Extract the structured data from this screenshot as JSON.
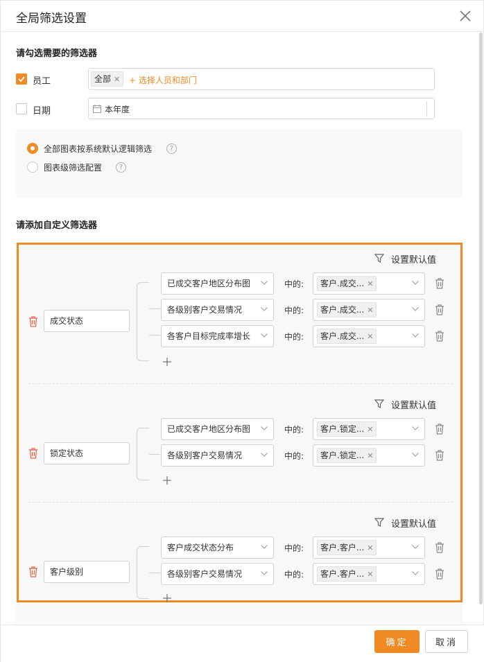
{
  "dialog": {
    "title": "全局筛选设置"
  },
  "section1": {
    "title": "请勾选需要的筛选器",
    "employee": {
      "label": "员工",
      "checked": true,
      "tag": "全部",
      "add_link": "+ 选择人员和部门"
    },
    "date": {
      "label": "日期",
      "checked": false,
      "value": "本年度"
    }
  },
  "logic": {
    "options": [
      {
        "label": "全部图表按系统默认逻辑筛选",
        "selected": true
      },
      {
        "label": "图表级筛选配置",
        "selected": false
      }
    ]
  },
  "section2": {
    "title": "请添加自定义筛选器",
    "set_default_label": "设置默认值",
    "in_label": "中的:",
    "groups": [
      {
        "name": "成交状态",
        "rows": [
          {
            "chart": "已成交客户地区分布图",
            "field": "客户.成交..."
          },
          {
            "chart": "各级别客户交易情况",
            "field": "客户.成交..."
          },
          {
            "chart": "各客户目标完成率增长",
            "field": "客户.成交..."
          }
        ]
      },
      {
        "name": "锁定状态",
        "rows": [
          {
            "chart": "已成交客户地区分布图",
            "field": "客户.锁定..."
          },
          {
            "chart": "各级别客户交易情况",
            "field": "客户.锁定..."
          }
        ]
      },
      {
        "name": "客户级别",
        "rows": [
          {
            "chart": "客户成交状态分布",
            "field": "客户.客户..."
          },
          {
            "chart": "各级别客户交易情况",
            "field": "客户.客户..."
          }
        ]
      }
    ]
  },
  "footer": {
    "ok_label": "确定",
    "cancel_label": "取消"
  },
  "colors": {
    "accent": "#f08a24",
    "delete": "#f06040"
  }
}
